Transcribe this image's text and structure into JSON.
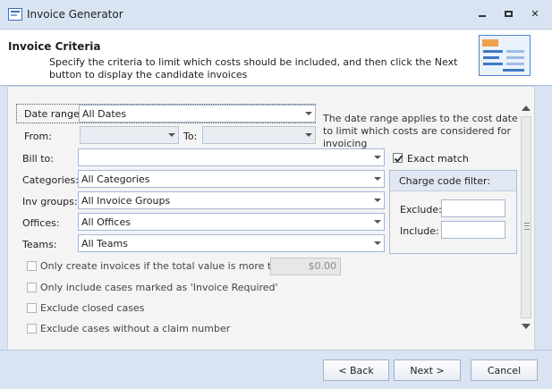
{
  "window": {
    "title": "Invoice Generator",
    "minimize_icon": "minimize-icon",
    "maximize_icon": "maximize-icon",
    "close_glyph": "✕"
  },
  "header": {
    "title": "Invoice Criteria",
    "description": "Specify the criteria to limit which costs should be included, and then click the Next button to display the candidate invoices",
    "icon": "invoice-document-icon"
  },
  "criteria": {
    "date_range": {
      "label": "Date range:",
      "value": "All Dates"
    },
    "from": {
      "label": "From:",
      "value": ""
    },
    "to": {
      "label": "To:",
      "value": ""
    },
    "date_note": "The date range applies to the cost date to limit which costs are considered for invoicing",
    "bill_to": {
      "label": "Bill to:",
      "value": ""
    },
    "exact_match": {
      "label": "Exact match",
      "checked": true
    },
    "categories": {
      "label": "Categories:",
      "value": "All Categories"
    },
    "inv_groups": {
      "label": "Inv groups:",
      "value": "All Invoice Groups"
    },
    "offices": {
      "label": "Offices:",
      "value": "All Offices"
    },
    "teams": {
      "label": "Teams:",
      "value": "All Teams"
    },
    "charge_code_filter": {
      "title": "Charge code filter:",
      "exclude_label": "Exclude:",
      "exclude_value": "",
      "include_label": "Include:",
      "include_value": ""
    },
    "options": [
      {
        "label": "Only create invoices if the total value is more than:",
        "checked": false
      },
      {
        "label": "Only include cases marked as 'Invoice Required'",
        "checked": false
      },
      {
        "label": "Exclude closed cases",
        "checked": false
      },
      {
        "label": "Exclude cases without a claim number",
        "checked": false
      }
    ],
    "min_total_value": "$0.00"
  },
  "buttons": {
    "back": "< Back",
    "next": "Next >",
    "cancel": "Cancel"
  },
  "colors": {
    "window_bg": "#d9e3f1",
    "content_bg": "#f4f4f4",
    "border": "#a4b7d2"
  }
}
